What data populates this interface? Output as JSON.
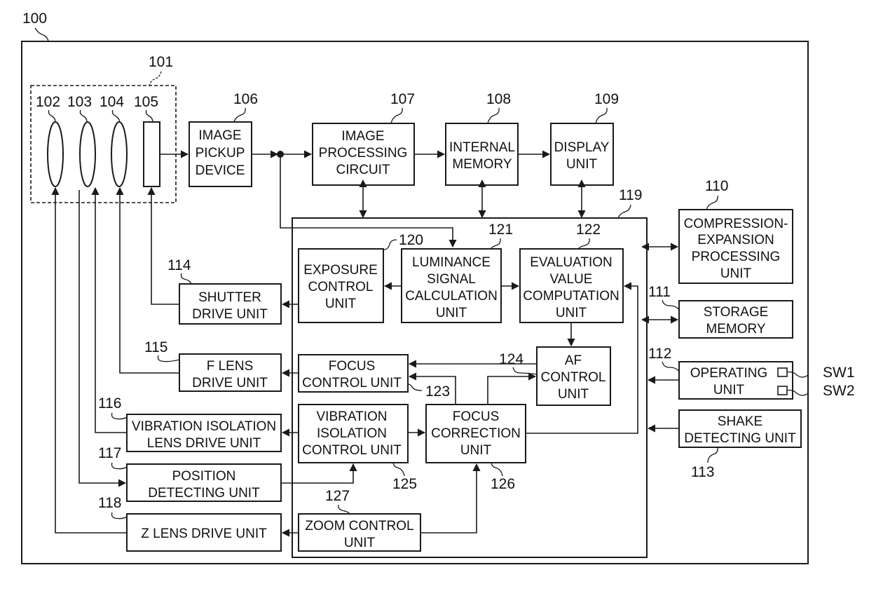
{
  "diagram": {
    "refs": {
      "camera": "100",
      "lens_unit": "101",
      "lens_102": "102",
      "lens_103": "103",
      "lens_104": "104",
      "shutter_105": "105",
      "image_pickup": "106",
      "image_processing": "107",
      "internal_memory": "108",
      "display_unit": "109",
      "compression": "110",
      "storage_memory": "111",
      "operating_unit": "112",
      "shake_detecting": "113",
      "shutter_drive": "114",
      "f_lens_drive": "115",
      "vibration_lens_drive": "116",
      "position_detecting": "117",
      "z_lens_drive": "118",
      "controller": "119",
      "exposure_control": "120",
      "luminance": "121",
      "evaluation": "122",
      "focus_control": "123",
      "af_control": "124",
      "vibration_control": "125",
      "focus_correction": "126",
      "zoom_control": "127"
    },
    "blocks": {
      "image_pickup": [
        "IMAGE",
        "PICKUP",
        "DEVICE"
      ],
      "image_processing": [
        "IMAGE",
        "PROCESSING",
        "CIRCUIT"
      ],
      "internal_memory": [
        "INTERNAL",
        "MEMORY"
      ],
      "display_unit": [
        "DISPLAY",
        "UNIT"
      ],
      "compression": [
        "COMPRESSION-",
        "EXPANSION",
        "PROCESSING",
        "UNIT"
      ],
      "storage_memory": [
        "STORAGE",
        "MEMORY"
      ],
      "operating_unit": [
        "OPERATING",
        "UNIT"
      ],
      "shake_detecting": [
        "SHAKE",
        "DETECTING UNIT"
      ],
      "shutter_drive": [
        "SHUTTER",
        "DRIVE UNIT"
      ],
      "f_lens_drive": [
        "F LENS",
        "DRIVE UNIT"
      ],
      "vibration_lens_drive": [
        "VIBRATION ISOLATION",
        "LENS DRIVE UNIT"
      ],
      "position_detecting": [
        "POSITION",
        "DETECTING UNIT"
      ],
      "z_lens_drive": [
        "Z LENS DRIVE UNIT"
      ],
      "exposure_control": [
        "EXPOSURE",
        "CONTROL",
        "UNIT"
      ],
      "luminance": [
        "LUMINANCE",
        "SIGNAL",
        "CALCULATION",
        "UNIT"
      ],
      "evaluation": [
        "EVALUATION",
        "VALUE",
        "COMPUTATION",
        "UNIT"
      ],
      "focus_control": [
        "FOCUS",
        "CONTROL UNIT"
      ],
      "af_control": [
        "AF",
        "CONTROL",
        "UNIT"
      ],
      "vibration_control": [
        "VIBRATION",
        "ISOLATION",
        "CONTROL UNIT"
      ],
      "focus_correction": [
        "FOCUS",
        "CORRECTION",
        "UNIT"
      ],
      "zoom_control": [
        "ZOOM CONTROL",
        "UNIT"
      ]
    },
    "switches": {
      "sw1": "SW1",
      "sw2": "SW2"
    }
  }
}
